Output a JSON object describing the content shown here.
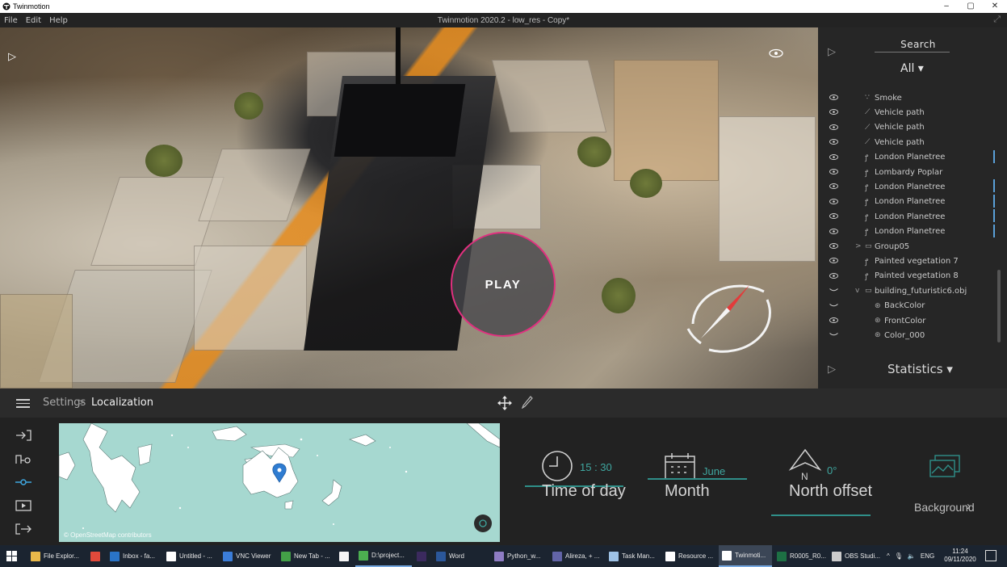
{
  "window": {
    "app_name": "Twinmotion",
    "controls": [
      "–",
      "▢",
      "✕"
    ]
  },
  "menubar": {
    "items": [
      "File",
      "Edit",
      "Help"
    ],
    "document_title": "Twinmotion 2020.2 - low_res - Copy*"
  },
  "viewport": {
    "play_label": "PLAY"
  },
  "scene_panel": {
    "search_label": "Search",
    "filter_label": "All ▾",
    "items": [
      {
        "label": "Smoke",
        "icon": "∵",
        "indent": 0,
        "eye": "open",
        "selected": false
      },
      {
        "label": "Vehicle path",
        "icon": "⟋",
        "indent": 0,
        "eye": "open",
        "selected": false
      },
      {
        "label": "Vehicle path",
        "icon": "⟋",
        "indent": 0,
        "eye": "open",
        "selected": false
      },
      {
        "label": "Vehicle path",
        "icon": "⟋",
        "indent": 0,
        "eye": "open",
        "selected": false
      },
      {
        "label": "London Planetree",
        "icon": "ꝭ",
        "indent": 0,
        "eye": "open",
        "selected": true
      },
      {
        "label": "Lombardy Poplar",
        "icon": "ꝭ",
        "indent": 0,
        "eye": "open",
        "selected": false
      },
      {
        "label": "London Planetree",
        "icon": "ꝭ",
        "indent": 0,
        "eye": "open",
        "selected": true
      },
      {
        "label": "London Planetree",
        "icon": "ꝭ",
        "indent": 0,
        "eye": "open",
        "selected": true
      },
      {
        "label": "London Planetree",
        "icon": "ꝭ",
        "indent": 0,
        "eye": "open",
        "selected": true
      },
      {
        "label": "London Planetree",
        "icon": "ꝭ",
        "indent": 0,
        "eye": "open",
        "selected": true
      },
      {
        "label": "Group05",
        "icon": "▭",
        "indent": 0,
        "eye": "open",
        "selected": false,
        "expander": ">"
      },
      {
        "label": "Painted vegetation 7",
        "icon": "ꝭ",
        "indent": 0,
        "eye": "open",
        "selected": false
      },
      {
        "label": "Painted vegetation 8",
        "icon": "ꝭ",
        "indent": 0,
        "eye": "open",
        "selected": false
      },
      {
        "label": "building_futuristic6.obj",
        "icon": "▭",
        "indent": 0,
        "eye": "closed",
        "selected": false,
        "expander": "v"
      },
      {
        "label": "BackColor",
        "icon": "⊛",
        "indent": 1,
        "eye": "closed",
        "selected": false
      },
      {
        "label": "FrontColor",
        "icon": "⊛",
        "indent": 1,
        "eye": "open",
        "selected": false
      },
      {
        "label": "Color_000",
        "icon": "⊛",
        "indent": 1,
        "eye": "closed",
        "selected": false
      }
    ],
    "statistics_label": "Statistics ▾"
  },
  "toolbar": {
    "breadcrumb_settings": "Settings",
    "breadcrumb_separator": ">",
    "breadcrumb_current": "Localization"
  },
  "map": {
    "attribution": "© OpenStreetMap contributors"
  },
  "settings": {
    "time_of_day": {
      "label": "Time of day",
      "value": "15 : 30"
    },
    "month": {
      "label": "Month",
      "value": "June"
    },
    "north_offset": {
      "label": "North offset",
      "value": "0°",
      "compass_letter": "N"
    },
    "background": {
      "label": "Background"
    }
  },
  "taskbar": {
    "items": [
      {
        "label": "File Explor...",
        "color": "#e8b84a",
        "state": "normal"
      },
      {
        "label": "",
        "color": "#e24a3b",
        "state": "normal"
      },
      {
        "label": "Inbox - fa...",
        "color": "#2a74c7",
        "state": "normal"
      },
      {
        "label": "Untitled - ...",
        "color": "#ffffff",
        "state": "normal"
      },
      {
        "label": "VNC Viewer",
        "color": "#3b7dd8",
        "state": "normal"
      },
      {
        "label": "New Tab - ...",
        "color": "#43a047",
        "state": "normal"
      },
      {
        "label": "",
        "color": "#f5f5f5",
        "state": "normal"
      },
      {
        "label": "D:\\project...",
        "color": "#4caf50",
        "state": "open"
      },
      {
        "label": "",
        "color": "#3b2a5e",
        "state": "normal"
      },
      {
        "label": "Word",
        "color": "#2b579a",
        "state": "normal"
      },
      {
        "label": "Python_w...",
        "color": "#8e7cc3",
        "state": "normal"
      },
      {
        "label": "Alireza, + ...",
        "color": "#6264a7",
        "state": "normal"
      },
      {
        "label": "Task Man...",
        "color": "#9ec2e6",
        "state": "normal"
      },
      {
        "label": "Resource ...",
        "color": "#ffffff",
        "state": "normal"
      },
      {
        "label": "Twinmoti...",
        "color": "#ffffff",
        "state": "active"
      },
      {
        "label": "R0005_R0...",
        "color": "#1d7044",
        "state": "normal"
      },
      {
        "label": "OBS Studi...",
        "color": "#cccccc",
        "state": "normal"
      }
    ],
    "language": "ENG",
    "time": "11:24",
    "date": "09/11/2020"
  }
}
